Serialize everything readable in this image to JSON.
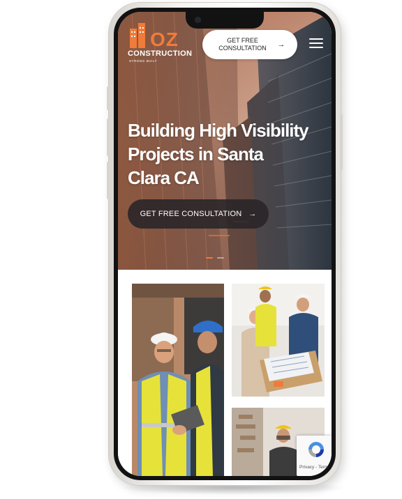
{
  "brand": {
    "logo_text": "OZ",
    "wordmark": "CONSTRUCTION",
    "tagline": "STRONG BUILT",
    "accent_color": "#f07b3a"
  },
  "header": {
    "cta_label": "GET FREE\nCONSULTATION",
    "cta_icon": "arrow-right-icon",
    "menu_icon": "hamburger-menu-icon"
  },
  "hero": {
    "title": "Building High Visibility\nProjects in Santa\nClara CA",
    "cta_label": "GET FREE CONSULTATION",
    "cta_icon": "arrow-right-icon",
    "slides": 2,
    "active_slide": 1
  },
  "gallery": {
    "photos": [
      {
        "name": "two-workers-handshake-photo"
      },
      {
        "name": "team-reviewing-blueprints-photo"
      },
      {
        "name": "worker-demolition-photo"
      }
    ]
  },
  "recaptcha": {
    "label": "Privacy - Terms"
  }
}
